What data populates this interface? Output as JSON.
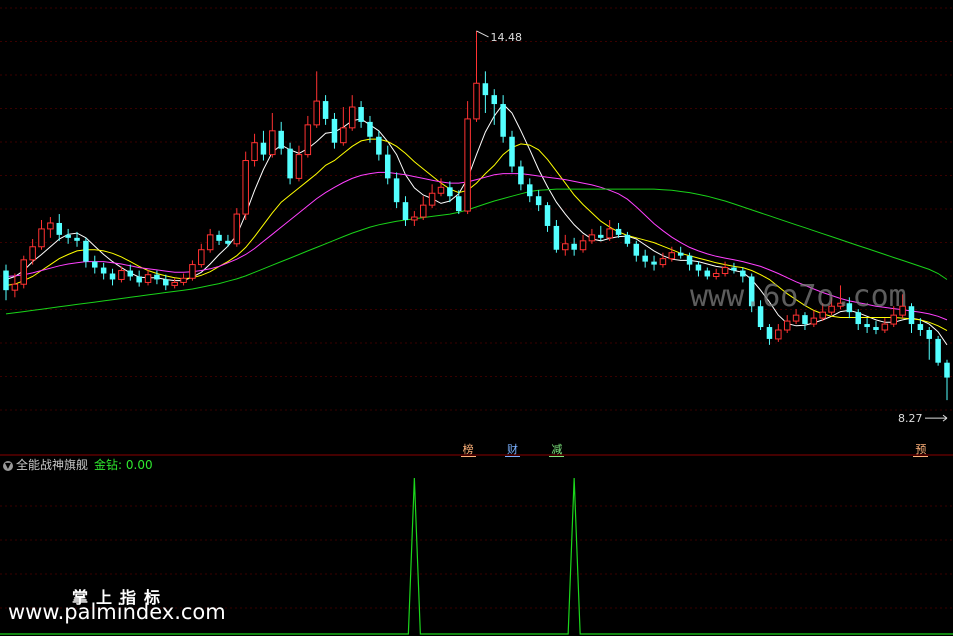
{
  "chart_data": [
    {
      "type": "candlestick",
      "price_labels": {
        "high": "14.48",
        "low": "8.27"
      },
      "ylim": [
        7.6,
        15.0
      ],
      "grid": true,
      "candles": [
        [
          10.45,
          10.12,
          10.55,
          9.95
        ],
        [
          10.12,
          10.22,
          10.4,
          10.0
        ],
        [
          10.22,
          10.63,
          10.7,
          10.15
        ],
        [
          10.63,
          10.85,
          10.98,
          10.55
        ],
        [
          10.85,
          11.15,
          11.3,
          10.8
        ],
        [
          11.15,
          11.25,
          11.35,
          11.0
        ],
        [
          11.25,
          11.05,
          11.4,
          10.95
        ],
        [
          11.05,
          11.0,
          11.15,
          10.9
        ],
        [
          11.0,
          10.95,
          11.1,
          10.85
        ],
        [
          10.95,
          10.6,
          11.0,
          10.5
        ],
        [
          10.6,
          10.5,
          10.7,
          10.4
        ],
        [
          10.5,
          10.4,
          10.58,
          10.3
        ],
        [
          10.4,
          10.3,
          10.48,
          10.2
        ],
        [
          10.3,
          10.45,
          10.52,
          10.25
        ],
        [
          10.45,
          10.35,
          10.55,
          10.28
        ],
        [
          10.35,
          10.25,
          10.45,
          10.18
        ],
        [
          10.25,
          10.38,
          10.46,
          10.2
        ],
        [
          10.38,
          10.3,
          10.45,
          10.22
        ],
        [
          10.3,
          10.2,
          10.38,
          10.12
        ],
        [
          10.2,
          10.25,
          10.32,
          10.15
        ],
        [
          10.25,
          10.32,
          10.4,
          10.2
        ],
        [
          10.32,
          10.55,
          10.62,
          10.28
        ],
        [
          10.55,
          10.8,
          10.9,
          10.5
        ],
        [
          10.8,
          11.05,
          11.15,
          10.75
        ],
        [
          11.05,
          10.95,
          11.12,
          10.88
        ],
        [
          10.95,
          10.9,
          11.05,
          10.85
        ],
        [
          10.9,
          11.4,
          11.5,
          10.85
        ],
        [
          11.4,
          12.3,
          12.45,
          11.3
        ],
        [
          12.3,
          12.6,
          12.75,
          12.2
        ],
        [
          12.6,
          12.4,
          12.8,
          12.3
        ],
        [
          12.4,
          12.8,
          13.1,
          12.35
        ],
        [
          12.8,
          12.5,
          12.95,
          12.4
        ],
        [
          12.5,
          12.0,
          12.6,
          11.9
        ],
        [
          12.0,
          12.4,
          12.55,
          11.95
        ],
        [
          12.4,
          12.9,
          13.05,
          12.35
        ],
        [
          12.9,
          13.3,
          13.8,
          12.85
        ],
        [
          13.3,
          13.0,
          13.4,
          12.9
        ],
        [
          13.0,
          12.6,
          13.1,
          12.5
        ],
        [
          12.6,
          12.85,
          13.2,
          12.55
        ],
        [
          12.85,
          13.2,
          13.4,
          12.8
        ],
        [
          13.2,
          12.95,
          13.3,
          12.85
        ],
        [
          12.95,
          12.7,
          13.05,
          12.6
        ],
        [
          12.7,
          12.4,
          12.8,
          12.3
        ],
        [
          12.4,
          12.0,
          12.55,
          11.9
        ],
        [
          12.0,
          11.6,
          12.1,
          11.5
        ],
        [
          11.6,
          11.3,
          11.7,
          11.2
        ],
        [
          11.3,
          11.35,
          11.45,
          11.2
        ],
        [
          11.35,
          11.55,
          11.7,
          11.3
        ],
        [
          11.55,
          11.75,
          11.9,
          11.5
        ],
        [
          11.75,
          11.85,
          12.0,
          11.7
        ],
        [
          11.85,
          11.7,
          11.95,
          11.6
        ],
        [
          11.7,
          11.45,
          11.8,
          11.4
        ],
        [
          11.45,
          13.0,
          13.3,
          11.4
        ],
        [
          13.0,
          13.6,
          14.48,
          12.95
        ],
        [
          13.6,
          13.4,
          13.8,
          13.1
        ],
        [
          13.4,
          13.25,
          13.5,
          12.9
        ],
        [
          13.25,
          12.7,
          13.4,
          12.6
        ],
        [
          12.7,
          12.2,
          12.8,
          12.1
        ],
        [
          12.2,
          11.9,
          12.3,
          11.8
        ],
        [
          11.9,
          11.7,
          12.0,
          11.6
        ],
        [
          11.7,
          11.55,
          11.8,
          11.45
        ],
        [
          11.55,
          11.2,
          11.6,
          11.1
        ],
        [
          11.2,
          10.8,
          11.3,
          10.75
        ],
        [
          10.8,
          10.9,
          11.05,
          10.7
        ],
        [
          10.9,
          10.8,
          11.0,
          10.7
        ],
        [
          10.8,
          10.95,
          11.05,
          10.75
        ],
        [
          10.95,
          11.05,
          11.15,
          10.9
        ],
        [
          11.05,
          11.0,
          11.2,
          10.95
        ],
        [
          11.0,
          11.15,
          11.3,
          10.95
        ],
        [
          11.15,
          11.05,
          11.25,
          11.0
        ],
        [
          11.05,
          10.9,
          11.1,
          10.85
        ],
        [
          10.9,
          10.7,
          10.95,
          10.6
        ],
        [
          10.7,
          10.6,
          10.8,
          10.5
        ],
        [
          10.6,
          10.55,
          10.7,
          10.45
        ],
        [
          10.55,
          10.65,
          10.75,
          10.5
        ],
        [
          10.65,
          10.75,
          10.85,
          10.6
        ],
        [
          10.75,
          10.7,
          10.85,
          10.65
        ],
        [
          10.7,
          10.55,
          10.75,
          10.45
        ],
        [
          10.55,
          10.45,
          10.6,
          10.35
        ],
        [
          10.45,
          10.35,
          10.5,
          10.3
        ],
        [
          10.35,
          10.4,
          10.48,
          10.3
        ],
        [
          10.4,
          10.5,
          10.6,
          10.35
        ],
        [
          10.5,
          10.45,
          10.58,
          10.4
        ],
        [
          10.45,
          10.35,
          10.5,
          10.25
        ],
        [
          10.35,
          9.85,
          10.4,
          9.75
        ],
        [
          9.85,
          9.5,
          9.95,
          9.45
        ],
        [
          9.5,
          9.3,
          9.55,
          9.2
        ],
        [
          9.3,
          9.45,
          9.55,
          9.25
        ],
        [
          9.45,
          9.6,
          9.7,
          9.4
        ],
        [
          9.6,
          9.7,
          9.8,
          9.55
        ],
        [
          9.7,
          9.55,
          9.75,
          9.45
        ],
        [
          9.55,
          9.65,
          9.78,
          9.5
        ],
        [
          9.65,
          9.75,
          9.9,
          9.6
        ],
        [
          9.75,
          9.85,
          10.0,
          9.7
        ],
        [
          9.85,
          9.9,
          10.2,
          9.8
        ],
        [
          9.9,
          9.75,
          10.0,
          9.65
        ],
        [
          9.75,
          9.55,
          9.8,
          9.45
        ],
        [
          9.55,
          9.5,
          9.65,
          9.4
        ],
        [
          9.5,
          9.45,
          9.6,
          9.38
        ],
        [
          9.45,
          9.55,
          9.65,
          9.4
        ],
        [
          9.55,
          9.7,
          9.85,
          9.5
        ],
        [
          9.7,
          9.85,
          10.05,
          9.65
        ],
        [
          9.85,
          9.55,
          9.9,
          9.4
        ],
        [
          9.55,
          9.45,
          9.65,
          9.35
        ],
        [
          9.45,
          9.3,
          9.5,
          8.95
        ],
        [
          9.3,
          8.9,
          9.35,
          8.85
        ],
        [
          8.9,
          8.65,
          8.95,
          8.27
        ]
      ],
      "ma_lines": [
        {
          "name": "MA5",
          "color": "#ffffff",
          "values": [
            10.3,
            10.35,
            10.45,
            10.6,
            10.72,
            10.85,
            10.98,
            11.06,
            11.08,
            11.0,
            10.86,
            10.72,
            10.6,
            10.5,
            10.41,
            10.34,
            10.33,
            10.33,
            10.3,
            10.28,
            10.28,
            10.34,
            10.42,
            10.56,
            10.72,
            10.86,
            11.05,
            11.4,
            11.8,
            12.15,
            12.44,
            12.56,
            12.48,
            12.42,
            12.5,
            12.62,
            12.76,
            12.78,
            12.86,
            12.97,
            13.0,
            12.9,
            12.8,
            12.62,
            12.4,
            12.06,
            11.84,
            11.72,
            11.66,
            11.58,
            11.62,
            11.74,
            12.0,
            12.4,
            12.78,
            13.05,
            13.25,
            13.1,
            12.8,
            12.48,
            12.15,
            11.86,
            11.6,
            11.4,
            11.22,
            11.08,
            10.98,
            10.95,
            10.99,
            11.02,
            11.03,
            10.98,
            10.88,
            10.78,
            10.7,
            10.64,
            10.62,
            10.62,
            10.6,
            10.56,
            10.52,
            10.5,
            10.45,
            10.42,
            10.3,
            10.12,
            9.92,
            9.7,
            9.56,
            9.52,
            9.53,
            9.57,
            9.62,
            9.68,
            9.76,
            9.78,
            9.74,
            9.68,
            9.62,
            9.58,
            9.58,
            9.62,
            9.65,
            9.62,
            9.55,
            9.42,
            9.2
          ]
        },
        {
          "name": "MA10",
          "color": "#ffff00",
          "values": [
            10.2,
            10.22,
            10.28,
            10.35,
            10.45,
            10.55,
            10.65,
            10.72,
            10.78,
            10.8,
            10.8,
            10.78,
            10.74,
            10.68,
            10.6,
            10.52,
            10.45,
            10.4,
            10.36,
            10.33,
            10.31,
            10.33,
            10.37,
            10.43,
            10.52,
            10.6,
            10.7,
            10.84,
            11.02,
            11.22,
            11.42,
            11.6,
            11.72,
            11.84,
            11.96,
            12.08,
            12.22,
            12.3,
            12.42,
            12.54,
            12.63,
            12.66,
            12.66,
            12.62,
            12.54,
            12.42,
            12.28,
            12.16,
            12.04,
            11.92,
            11.82,
            11.76,
            11.8,
            11.92,
            12.08,
            12.22,
            12.4,
            12.52,
            12.58,
            12.56,
            12.48,
            12.32,
            12.12,
            11.92,
            11.72,
            11.56,
            11.42,
            11.28,
            11.18,
            11.1,
            11.04,
            11.0,
            10.96,
            10.92,
            10.86,
            10.8,
            10.74,
            10.7,
            10.66,
            10.62,
            10.58,
            10.55,
            10.52,
            10.5,
            10.45,
            10.38,
            10.3,
            10.18,
            10.06,
            9.96,
            9.86,
            9.78,
            9.72,
            9.68,
            9.66,
            9.66,
            9.66,
            9.66,
            9.66,
            9.66,
            9.66,
            9.65,
            9.64,
            9.62,
            9.58,
            9.52,
            9.44
          ]
        },
        {
          "name": "MA20",
          "color": "#ff40ff",
          "values": [
            10.35,
            10.36,
            10.38,
            10.41,
            10.45,
            10.49,
            10.53,
            10.56,
            10.58,
            10.6,
            10.6,
            10.6,
            10.58,
            10.56,
            10.53,
            10.5,
            10.48,
            10.46,
            10.44,
            10.42,
            10.42,
            10.43,
            10.45,
            10.48,
            10.52,
            10.58,
            10.64,
            10.72,
            10.82,
            10.94,
            11.06,
            11.18,
            11.3,
            11.42,
            11.54,
            11.66,
            11.76,
            11.85,
            11.93,
            12.0,
            12.05,
            12.08,
            12.1,
            12.1,
            12.08,
            12.06,
            12.03,
            12.0,
            11.97,
            11.94,
            11.92,
            11.92,
            11.94,
            11.98,
            12.02,
            12.06,
            12.08,
            12.08,
            12.08,
            12.06,
            12.04,
            12.02,
            12.0,
            11.98,
            11.95,
            11.92,
            11.89,
            11.85,
            11.8,
            11.74,
            11.65,
            11.52,
            11.38,
            11.24,
            11.12,
            11.01,
            10.92,
            10.84,
            10.78,
            10.73,
            10.69,
            10.66,
            10.63,
            10.6,
            10.56,
            10.52,
            10.46,
            10.4,
            10.33,
            10.26,
            10.2,
            10.14,
            10.08,
            10.03,
            9.98,
            9.94,
            9.91,
            9.88,
            9.85,
            9.83,
            9.81,
            9.79,
            9.77,
            9.75,
            9.72,
            9.68,
            9.62
          ]
        },
        {
          "name": "MA60",
          "color": "#19d219",
          "values": [
            9.72,
            9.74,
            9.76,
            9.78,
            9.8,
            9.82,
            9.84,
            9.86,
            9.88,
            9.9,
            9.92,
            9.94,
            9.96,
            9.98,
            10.0,
            10.02,
            10.04,
            10.06,
            10.08,
            10.1,
            10.12,
            10.14,
            10.17,
            10.2,
            10.23,
            10.27,
            10.31,
            10.36,
            10.42,
            10.48,
            10.54,
            10.6,
            10.66,
            10.72,
            10.78,
            10.84,
            10.9,
            10.96,
            11.02,
            11.08,
            11.13,
            11.18,
            11.22,
            11.25,
            11.28,
            11.3,
            11.32,
            11.34,
            11.36,
            11.38,
            11.4,
            11.43,
            11.47,
            11.52,
            11.57,
            11.62,
            11.66,
            11.7,
            11.74,
            11.78,
            11.8,
            11.81,
            11.82,
            11.82,
            11.82,
            11.82,
            11.82,
            11.82,
            11.82,
            11.82,
            11.82,
            11.82,
            11.82,
            11.82,
            11.81,
            11.8,
            11.78,
            11.76,
            11.73,
            11.7,
            11.66,
            11.62,
            11.57,
            11.52,
            11.47,
            11.42,
            11.37,
            11.32,
            11.27,
            11.22,
            11.17,
            11.12,
            11.07,
            11.02,
            10.97,
            10.92,
            10.87,
            10.82,
            10.77,
            10.72,
            10.67,
            10.62,
            10.57,
            10.52,
            10.47,
            10.4,
            10.3
          ]
        }
      ],
      "markers": [
        {
          "candle": 52,
          "text": "榜",
          "color": "#ffb27a"
        },
        {
          "candle": 57,
          "text": "财",
          "color": "#7ab0ff"
        },
        {
          "candle": 62,
          "text": "减",
          "color": "#7ee87e"
        },
        {
          "candle": 103,
          "text": "预",
          "color": "#ffb27a"
        }
      ]
    },
    {
      "type": "line",
      "title": "全能战神旗舰",
      "indicator_label": "金钻: 0.00",
      "spikes_at_candles": [
        46,
        64
      ],
      "ylim": [
        0,
        1
      ],
      "color": "#1cd61c"
    }
  ],
  "watermarks": {
    "center": "www.6o7o.com",
    "bottom_title": "掌上指标",
    "bottom_url": "www.palmindex.com"
  }
}
